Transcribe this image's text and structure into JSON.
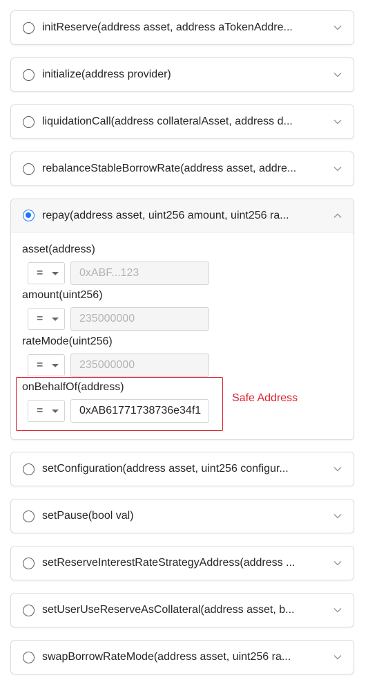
{
  "functions": [
    {
      "signature": "initReserve(address asset, address aTokenAddre...",
      "selected": false
    },
    {
      "signature": "initialize(address provider)",
      "selected": false
    },
    {
      "signature": "liquidationCall(address collateralAsset, address d...",
      "selected": false
    },
    {
      "signature": "rebalanceStableBorrowRate(address asset, addre...",
      "selected": false
    },
    {
      "signature": "repay(address asset, uint256 amount, uint256 ra...",
      "selected": true
    },
    {
      "signature": "setConfiguration(address asset, uint256 configur...",
      "selected": false
    },
    {
      "signature": "setPause(bool val)",
      "selected": false
    },
    {
      "signature": "setReserveInterestRateStrategyAddress(address ...",
      "selected": false
    },
    {
      "signature": "setUserUseReserveAsCollateral(address asset, b...",
      "selected": false
    },
    {
      "signature": "swapBorrowRateMode(address asset, uint256 ra...",
      "selected": false
    }
  ],
  "repay_params": [
    {
      "label": "asset(address)",
      "operator": "=",
      "placeholder": "0xABF...123",
      "value": ""
    },
    {
      "label": "amount(uint256)",
      "operator": "=",
      "placeholder": "235000000",
      "value": ""
    },
    {
      "label": "rateMode(uint256)",
      "operator": "=",
      "placeholder": "235000000",
      "value": ""
    },
    {
      "label": "onBehalfOf(address)",
      "operator": "=",
      "placeholder": "",
      "value": "0xAB61771738736e34f1"
    }
  ],
  "annotation": {
    "text": "Safe Address",
    "color": "#e0212e"
  },
  "colors": {
    "accent": "#1677ff",
    "border": "#dcdcdc",
    "highlight": "#d81e2a"
  }
}
